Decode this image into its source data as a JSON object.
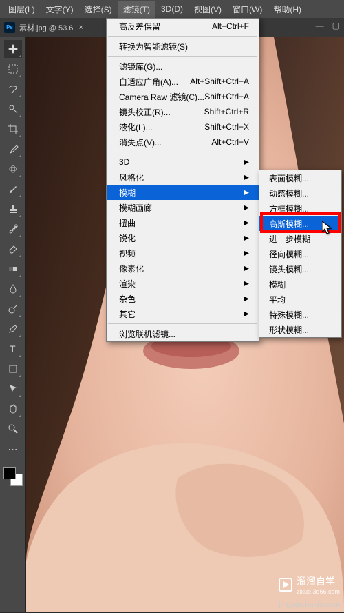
{
  "menubar": {
    "items": [
      {
        "label": "图层(L)"
      },
      {
        "label": "文字(Y)"
      },
      {
        "label": "选择(S)"
      },
      {
        "label": "滤镜(T)"
      },
      {
        "label": "3D(D)"
      },
      {
        "label": "视图(V)"
      },
      {
        "label": "窗口(W)"
      },
      {
        "label": "帮助(H)"
      }
    ]
  },
  "tab": {
    "title": "素材.jpg @ 53.6"
  },
  "filter_menu": {
    "items": [
      {
        "label": "高反差保留",
        "shortcut": "Alt+Ctrl+F"
      },
      {
        "sep": true
      },
      {
        "label": "转换为智能滤镜(S)"
      },
      {
        "sep": true
      },
      {
        "label": "滤镜库(G)..."
      },
      {
        "label": "自适应广角(A)...",
        "shortcut": "Alt+Shift+Ctrl+A"
      },
      {
        "label": "Camera Raw 滤镜(C)...",
        "shortcut": "Shift+Ctrl+A"
      },
      {
        "label": "镜头校正(R)...",
        "shortcut": "Shift+Ctrl+R"
      },
      {
        "label": "液化(L)...",
        "shortcut": "Shift+Ctrl+X"
      },
      {
        "label": "消失点(V)...",
        "shortcut": "Alt+Ctrl+V"
      },
      {
        "sep": true
      },
      {
        "label": "3D",
        "arrow": true
      },
      {
        "label": "风格化",
        "arrow": true
      },
      {
        "label": "模糊",
        "arrow": true,
        "hover": true
      },
      {
        "label": "模糊画廊",
        "arrow": true
      },
      {
        "label": "扭曲",
        "arrow": true
      },
      {
        "label": "锐化",
        "arrow": true
      },
      {
        "label": "视频",
        "arrow": true
      },
      {
        "label": "像素化",
        "arrow": true
      },
      {
        "label": "渲染",
        "arrow": true
      },
      {
        "label": "杂色",
        "arrow": true
      },
      {
        "label": "其它",
        "arrow": true
      },
      {
        "sep": true
      },
      {
        "label": "浏览联机滤镜..."
      }
    ]
  },
  "submenu": {
    "items": [
      {
        "label": "表面模糊..."
      },
      {
        "label": "动感模糊..."
      },
      {
        "label": "方框模糊..."
      },
      {
        "label": "高斯模糊...",
        "hover": true
      },
      {
        "label": "进一步模糊"
      },
      {
        "label": "径向模糊..."
      },
      {
        "label": "镜头模糊..."
      },
      {
        "label": "模糊"
      },
      {
        "label": "平均"
      },
      {
        "label": "特殊模糊..."
      },
      {
        "label": "形状模糊..."
      }
    ]
  },
  "brand": {
    "name": "溜溜自学",
    "site": "zixue.3d66.com"
  },
  "watermark": "jingyan.baidu.com"
}
